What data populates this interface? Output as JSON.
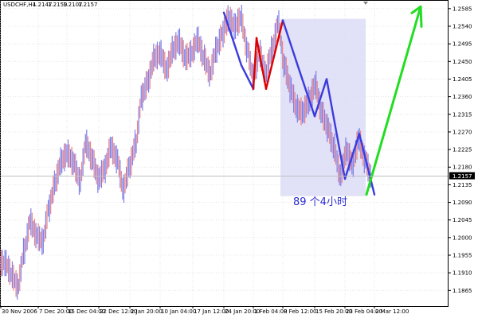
{
  "header": {
    "symbol_timeframe": "USDCHF,H4",
    "ohlc": [
      "1.2147",
      "1.2159",
      "1.2107",
      "1.2157"
    ]
  },
  "annotation": {
    "label": "89  个4小时"
  },
  "colors": {
    "bull": "#7e7ee8",
    "bear": "#f08080",
    "zigzag_down": "#3b3bdd",
    "zigzag_red": "#dd0000",
    "projection": "#22dd22",
    "highlight": "#dcdcf6",
    "price_tag": "#000000"
  },
  "chart_data": {
    "type": "line",
    "title": "",
    "ylim": [
      1.1825,
      1.2605
    ],
    "y_ticks": [
      "1.2585",
      "1.2540",
      "1.2495",
      "1.2450",
      "1.2405",
      "1.2360",
      "1.2315",
      "1.2270",
      "1.2225",
      "1.2180",
      "1.2135",
      "1.2090",
      "1.2045",
      "1.2000",
      "1.1955",
      "1.1910",
      "1.1865"
    ],
    "x_ticks": [
      "30 Nov 2006",
      "7 Dec 20:00",
      "15 Dec 04:00",
      "22 Dec 12:00",
      "2 Jan 20:00",
      "10 Jan 04:00",
      "17 Jan 12:00",
      "24 Jan 20:00",
      "1 Feb 04:00",
      "8 Feb 12:00",
      "15 Feb 20:00",
      "23 Feb 04:00",
      "2 Mar 12:00"
    ],
    "current_price": "1.2157",
    "price_series_name": "USDCHF H4",
    "price_series_close": [
      1.1935,
      1.1905,
      1.1875,
      1.1965,
      1.204,
      1.2005,
      1.199,
      1.2075,
      1.214,
      1.2195,
      1.2215,
      1.219,
      1.2145,
      1.224,
      1.22,
      1.215,
      1.2175,
      1.223,
      1.22,
      1.2125,
      1.218,
      1.224,
      1.236,
      1.24,
      1.246,
      1.247,
      1.243,
      1.248,
      1.25,
      1.246,
      1.247,
      1.2505,
      1.246,
      1.242,
      1.248,
      1.252,
      1.256,
      1.254,
      1.256,
      1.248,
      1.241,
      1.247,
      1.242,
      1.248,
      1.2545,
      1.244,
      1.238,
      1.233,
      1.232,
      1.235,
      1.239,
      1.232,
      1.228,
      1.223,
      1.216,
      1.222,
      1.219,
      1.225,
      1.22,
      1.2157
    ],
    "zigzag": [
      {
        "x": "24 Jan 20:00",
        "y": 1.2575
      },
      {
        "x": "29 Jan 12:00",
        "y": 1.244
      },
      {
        "x": "1 Feb 04:00",
        "y": 1.238
      },
      {
        "x": "2 Feb 16:00",
        "y": 1.251
      },
      {
        "x": "5 Feb 20:00",
        "y": 1.238
      },
      {
        "x": "8 Feb 12:00",
        "y": 1.2555
      },
      {
        "x": "12 Feb 04:00",
        "y": 1.245
      },
      {
        "x": "15 Feb 20:00",
        "y": 1.231
      },
      {
        "x": "19 Feb 12:00",
        "y": 1.2405
      },
      {
        "x": "23 Feb 04:00",
        "y": 1.215
      },
      {
        "x": "26 Feb 12:00",
        "y": 1.2265
      },
      {
        "x": "2 Mar 12:00",
        "y": 1.211
      }
    ],
    "projection": [
      {
        "x": "2 Mar 12:00",
        "y": 1.211
      },
      {
        "x": "projected",
        "y": 1.259
      }
    ],
    "highlighted_range": {
      "from": "8 Feb 12:00",
      "to": "2 Mar 12:00",
      "ymin": 1.211,
      "ymax": 1.2555
    }
  }
}
